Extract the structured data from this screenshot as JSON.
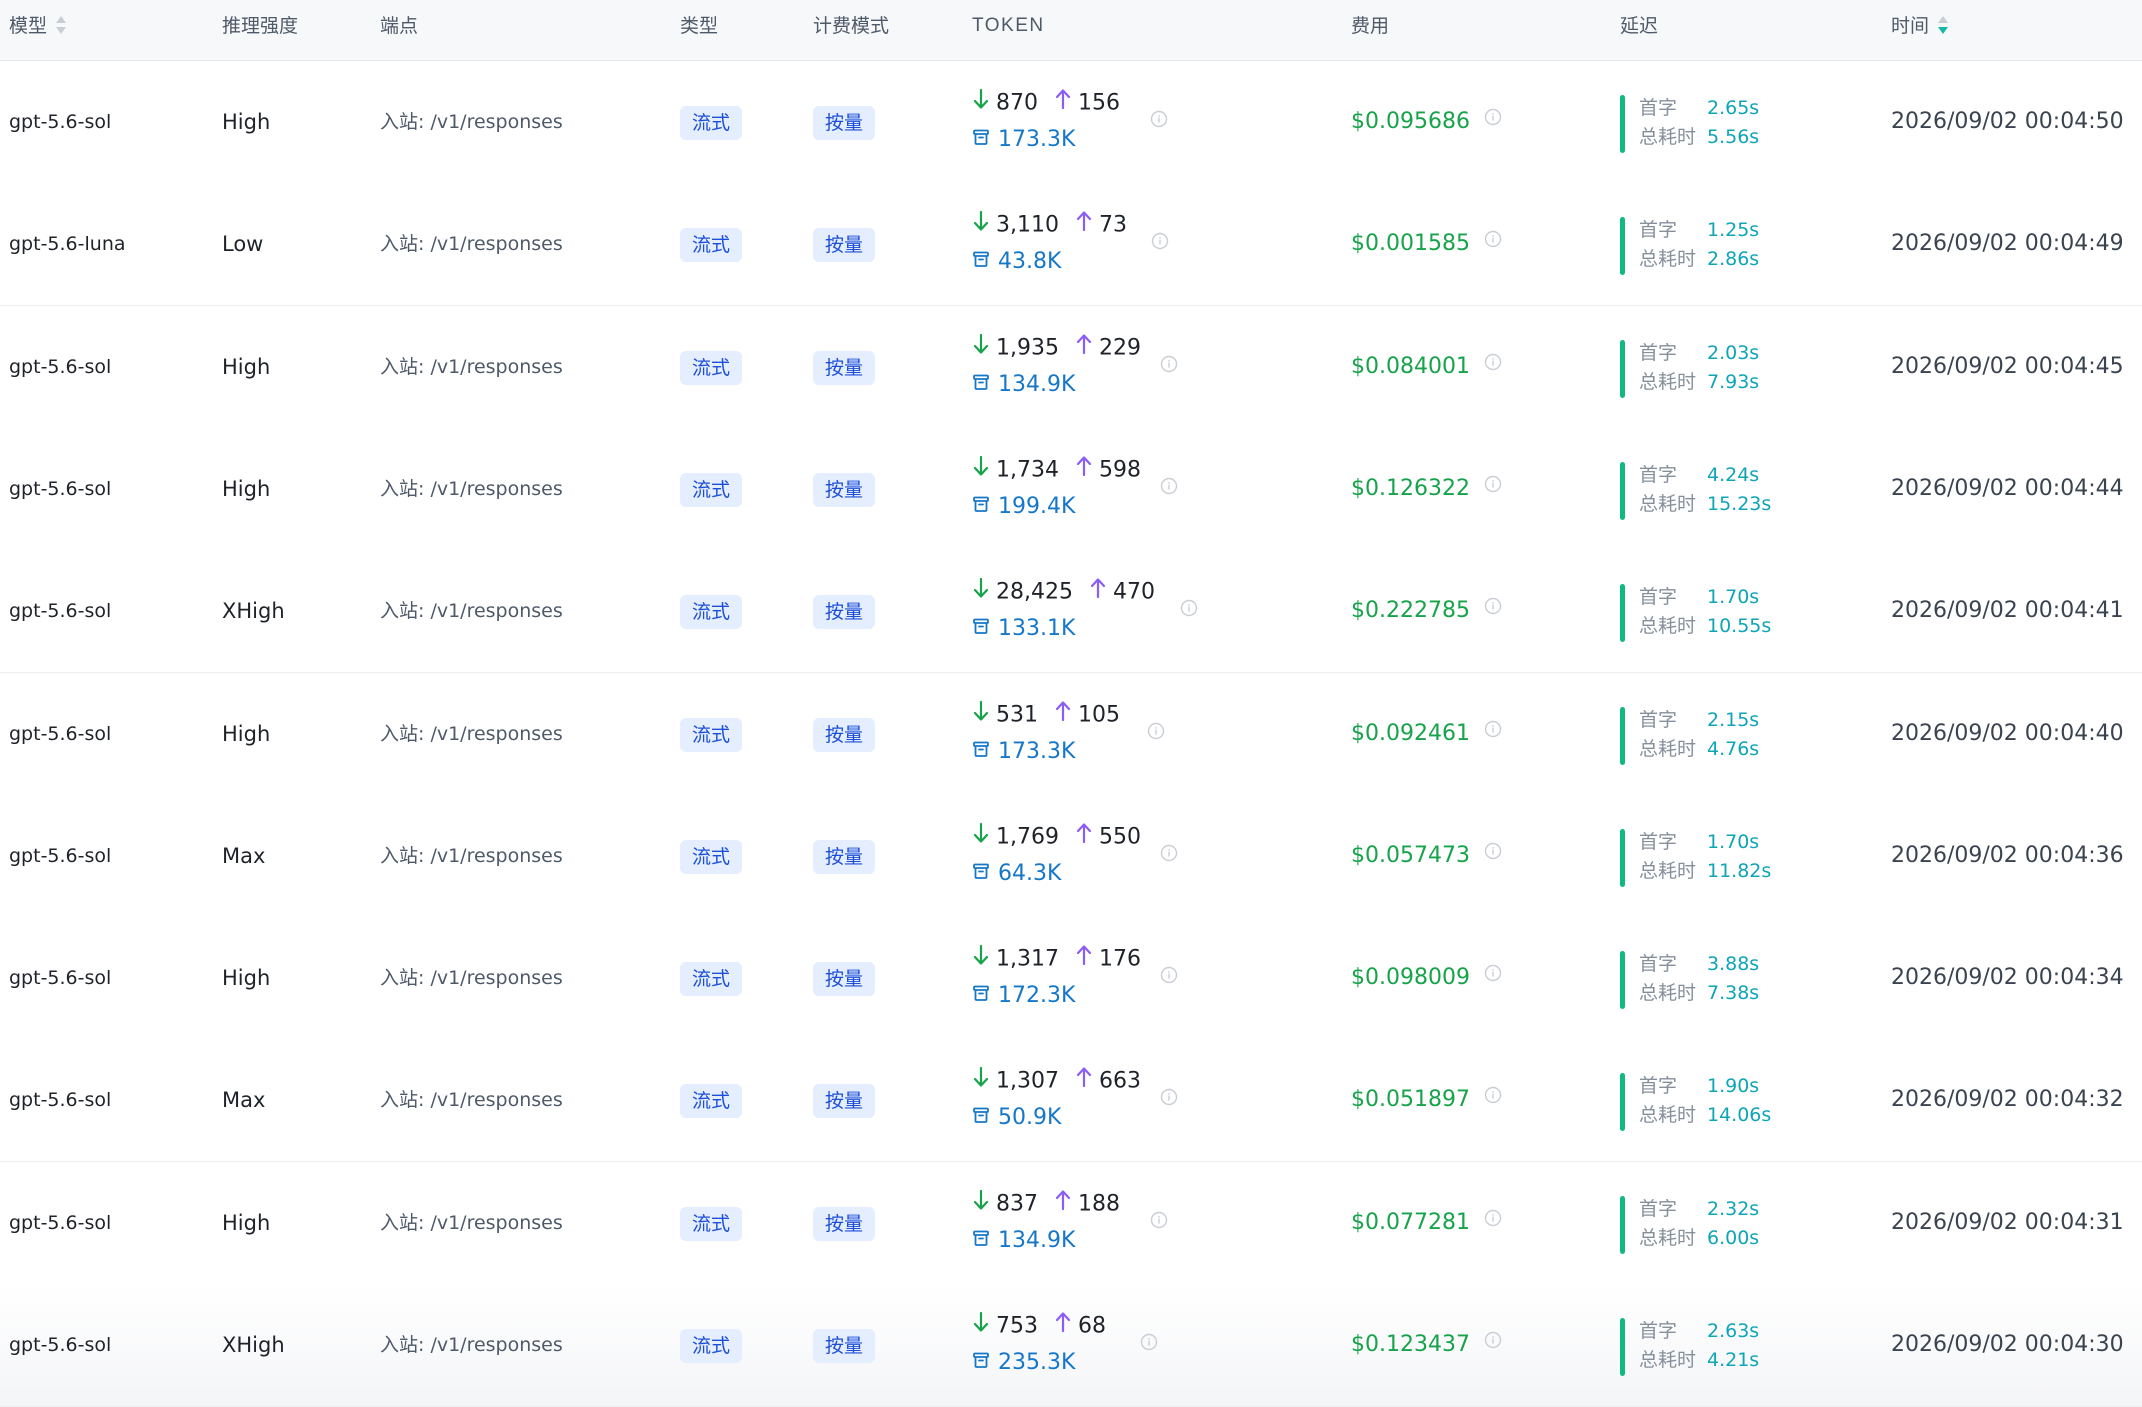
{
  "header": {
    "model": "模型",
    "effort": "推理强度",
    "endpoint": "端点",
    "type": "类型",
    "billing": "计费模式",
    "token": "TOKEN",
    "cost": "费用",
    "latency": "延迟",
    "time": "时间"
  },
  "labels": {
    "first_token": "首字",
    "total_time": "总耗时"
  },
  "colors": {
    "input_arrow": "#16a34a",
    "output_arrow": "#8b5cf6",
    "cache": "#1677c9",
    "cost": "#16a34a",
    "latency_bar": "#10b981",
    "tag_bg": "#e4eefe",
    "tag_text": "#1d4ed8"
  },
  "icons": {
    "input": "arrow-down-icon",
    "output": "arrow-up-icon",
    "cache": "cache-box-icon",
    "info": "info-circle-icon",
    "sort": "sort-caret-icon"
  },
  "rows": [
    {
      "model": "gpt-5.6-sol",
      "effort": "High",
      "endpoint": "入站: /v1/responses",
      "type": "流式",
      "billing": "按量",
      "input": "870",
      "output": "156",
      "cache": "173.3K",
      "cost": "$0.095686",
      "first": "2.65s",
      "total": "5.56s",
      "time": "2026/09/02 00:04:50"
    },
    {
      "model": "gpt-5.6-luna",
      "effort": "Low",
      "endpoint": "入站: /v1/responses",
      "type": "流式",
      "billing": "按量",
      "input": "3,110",
      "output": "73",
      "cache": "43.8K",
      "cost": "$0.001585",
      "first": "1.25s",
      "total": "2.86s",
      "time": "2026/09/02 00:04:49"
    },
    {
      "model": "gpt-5.6-sol",
      "effort": "High",
      "endpoint": "入站: /v1/responses",
      "type": "流式",
      "billing": "按量",
      "input": "1,935",
      "output": "229",
      "cache": "134.9K",
      "cost": "$0.084001",
      "first": "2.03s",
      "total": "7.93s",
      "time": "2026/09/02 00:04:45"
    },
    {
      "model": "gpt-5.6-sol",
      "effort": "High",
      "endpoint": "入站: /v1/responses",
      "type": "流式",
      "billing": "按量",
      "input": "1,734",
      "output": "598",
      "cache": "199.4K",
      "cost": "$0.126322",
      "first": "4.24s",
      "total": "15.23s",
      "time": "2026/09/02 00:04:44"
    },
    {
      "model": "gpt-5.6-sol",
      "effort": "XHigh",
      "endpoint": "入站: /v1/responses",
      "type": "流式",
      "billing": "按量",
      "input": "28,425",
      "output": "470",
      "cache": "133.1K",
      "cost": "$0.222785",
      "first": "1.70s",
      "total": "10.55s",
      "time": "2026/09/02 00:04:41"
    },
    {
      "model": "gpt-5.6-sol",
      "effort": "High",
      "endpoint": "入站: /v1/responses",
      "type": "流式",
      "billing": "按量",
      "input": "531",
      "output": "105",
      "cache": "173.3K",
      "cost": "$0.092461",
      "first": "2.15s",
      "total": "4.76s",
      "time": "2026/09/02 00:04:40"
    },
    {
      "model": "gpt-5.6-sol",
      "effort": "Max",
      "endpoint": "入站: /v1/responses",
      "type": "流式",
      "billing": "按量",
      "input": "1,769",
      "output": "550",
      "cache": "64.3K",
      "cost": "$0.057473",
      "first": "1.70s",
      "total": "11.82s",
      "time": "2026/09/02 00:04:36"
    },
    {
      "model": "gpt-5.6-sol",
      "effort": "High",
      "endpoint": "入站: /v1/responses",
      "type": "流式",
      "billing": "按量",
      "input": "1,317",
      "output": "176",
      "cache": "172.3K",
      "cost": "$0.098009",
      "first": "3.88s",
      "total": "7.38s",
      "time": "2026/09/02 00:04:34"
    },
    {
      "model": "gpt-5.6-sol",
      "effort": "Max",
      "endpoint": "入站: /v1/responses",
      "type": "流式",
      "billing": "按量",
      "input": "1,307",
      "output": "663",
      "cache": "50.9K",
      "cost": "$0.051897",
      "first": "1.90s",
      "total": "14.06s",
      "time": "2026/09/02 00:04:32"
    },
    {
      "model": "gpt-5.6-sol",
      "effort": "High",
      "endpoint": "入站: /v1/responses",
      "type": "流式",
      "billing": "按量",
      "input": "837",
      "output": "188",
      "cache": "134.9K",
      "cost": "$0.077281",
      "first": "2.32s",
      "total": "6.00s",
      "time": "2026/09/02 00:04:31"
    },
    {
      "model": "gpt-5.6-sol",
      "effort": "XHigh",
      "endpoint": "入站: /v1/responses",
      "type": "流式",
      "billing": "按量",
      "input": "753",
      "output": "68",
      "cache": "235.3K",
      "cost": "$0.123437",
      "first": "2.63s",
      "total": "4.21s",
      "time": "2026/09/02 00:04:30"
    }
  ]
}
